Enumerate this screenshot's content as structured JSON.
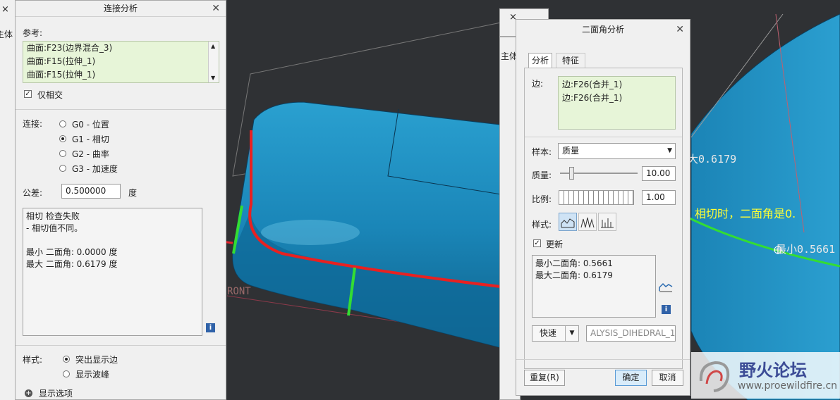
{
  "colors": {
    "model": "#1e88b8",
    "highlight_red": "#e82121",
    "green": "#33dd33",
    "arrow": "#e8232d",
    "annotation": "#ffff33"
  },
  "left_panel": {
    "title": "连接分析",
    "ref_label": "参考:",
    "refs": [
      "曲面:F23(边界混合_3)",
      "曲面:F15(拉伸_1)",
      "曲面:F15(拉伸_1)"
    ],
    "only_intersect": "仅相交",
    "connect_label": "连接:",
    "options": [
      "G0 - 位置",
      "G1 - 相切",
      "G2 - 曲率",
      "G3 - 加速度"
    ],
    "selected_option": "G1 - 相切",
    "tolerance_label": "公差:",
    "tolerance_value": "0.500000",
    "tolerance_unit": "度",
    "result_lines": [
      "相切 检查失败",
      "- 相切值不同。",
      "",
      "最小 二面角: 0.0000 度",
      "最大 二面角: 0.6179 度"
    ],
    "style_label": "样式:",
    "style_options": [
      "突出显示边",
      "显示波峰"
    ],
    "display_options": "显示选项"
  },
  "right_panel": {
    "title": "二面角分析",
    "tabs": [
      "分析",
      "特征"
    ],
    "edge_label": "边:",
    "edges": [
      "边:F26(合并_1)",
      "边:F26(合并_1)"
    ],
    "sample_label": "样本:",
    "sample_value": "质量",
    "quality_label": "质量:",
    "quality_value": "10.00",
    "quality_fraction": 0.15,
    "ratio_label": "比例:",
    "ratio_value": "1.00",
    "style_label": "样式:",
    "update_label": "更新",
    "result_lines": [
      "最小二面角: 0.5661",
      "最大二面角: 0.6179"
    ],
    "quick_label": "快速",
    "feature_name": "ALYSIS_DIHEDRAL_1",
    "repeat_btn": "重复(R)",
    "ok_btn": "确定",
    "cancel_btn": "取消"
  },
  "viewport": {
    "front_label": "RONT",
    "max_readout": "大0.6179",
    "min_readout": "最小0.5661",
    "annotation": "相切时，二面角是0.",
    "left_stub_x": "×",
    "left_stub_text": "主体",
    "right_stub_x": "×",
    "right_stub_text": "主体"
  },
  "watermark": {
    "title": "野火论坛",
    "url": "www.proewildfire.cn"
  }
}
